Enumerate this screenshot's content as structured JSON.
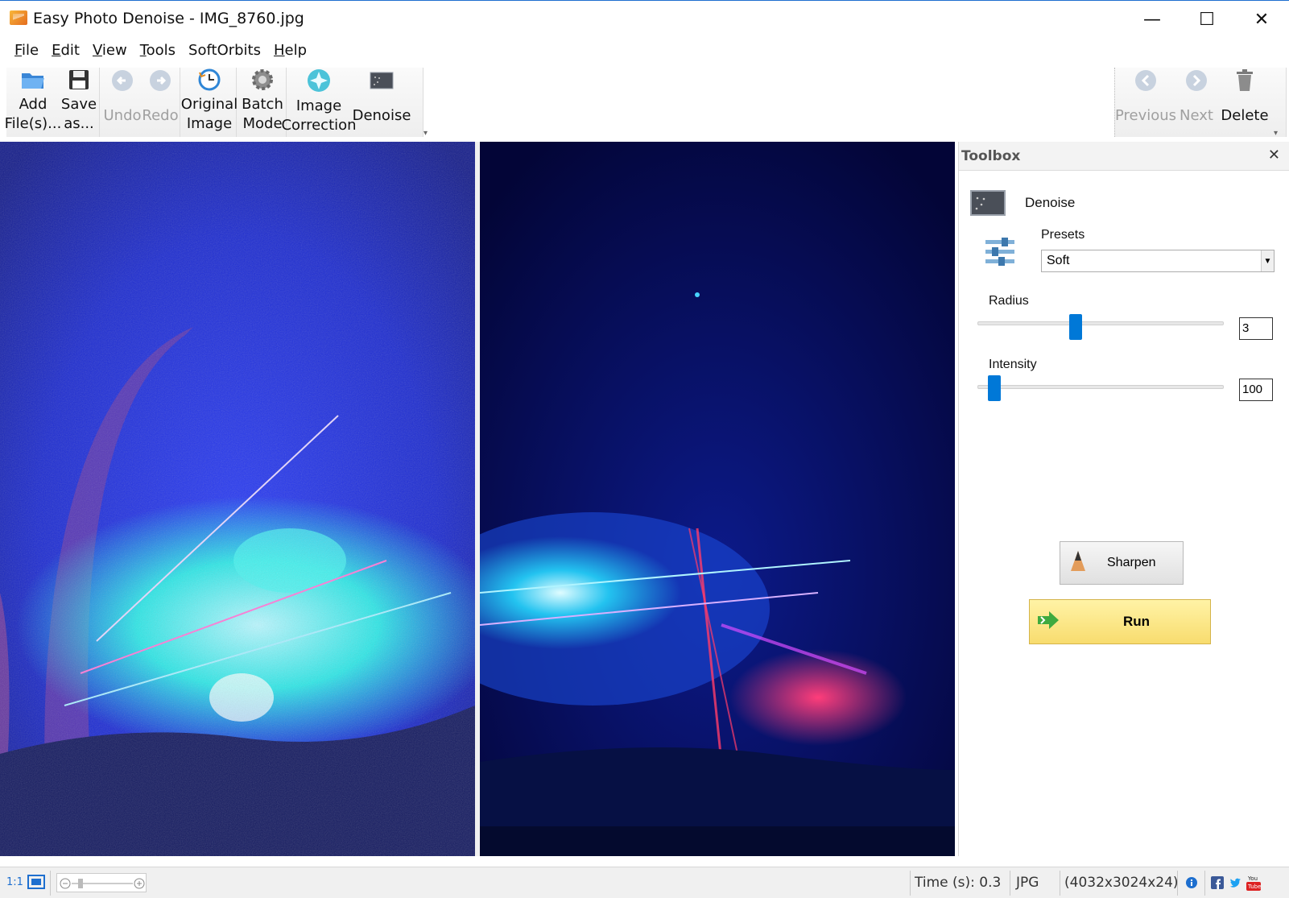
{
  "window": {
    "title": "Easy Photo Denoise - IMG_8760.jpg",
    "minimize_glyph": "—",
    "maximize_glyph": "☐",
    "close_glyph": "✕"
  },
  "menu": [
    {
      "acc": "F",
      "rest": "ile"
    },
    {
      "acc": "E",
      "rest": "dit"
    },
    {
      "acc": "V",
      "rest": "iew"
    },
    {
      "acc": "T",
      "rest": "ools"
    },
    {
      "acc": "",
      "rest": "SoftOrbits"
    },
    {
      "acc": "H",
      "rest": "elp"
    }
  ],
  "toolbar": {
    "add_files": "Add\nFile(s)...",
    "save_as": "Save\nas...",
    "undo": "Undo",
    "redo": "Redo",
    "original_image": "Original\nImage",
    "batch_mode": "Batch\nMode",
    "image_correction": "Image\nCorrection",
    "denoise": "Denoise",
    "previous": "Previous",
    "next": "Next",
    "delete": "Delete"
  },
  "toolbox": {
    "title": "Toolbox",
    "close_glyph": "✕",
    "tool_name": "Denoise",
    "presets_label": "Presets",
    "presets_value": "Soft",
    "radius_label": "Radius",
    "radius_value": "3",
    "radius_fraction": 0.4,
    "intensity_label": "Intensity",
    "intensity_value": "100",
    "intensity_fraction": 0.07,
    "sharpen_label": "Sharpen",
    "run_label": "Run"
  },
  "status": {
    "zoom_label": "1:1",
    "time": "Time (s): 0.3",
    "format": "JPG",
    "dimensions": "(4032x3024x24)"
  },
  "colors": {
    "accent_blue": "#0078d7",
    "run_yellow": "#f8dc6e"
  }
}
